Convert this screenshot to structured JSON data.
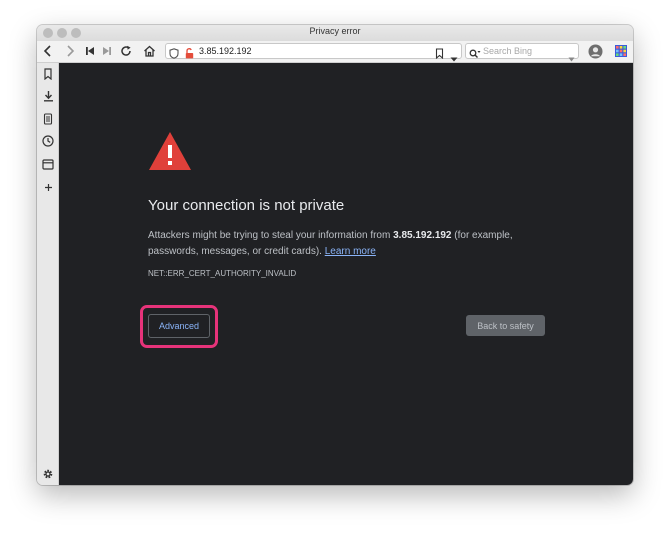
{
  "window": {
    "title": "Privacy error"
  },
  "toolbar": {
    "url": "3.85.192.192",
    "search_placeholder": "Search Bing"
  },
  "page": {
    "heading": "Your connection is not private",
    "description_prefix": "Attackers might be trying to steal your information from ",
    "description_host": "3.85.192.192",
    "description_suffix": " (for example, passwords, messages, or credit cards). ",
    "learn_more": "Learn more",
    "error_code": "NET::ERR_CERT_AUTHORITY_INVALID",
    "advanced_label": "Advanced",
    "back_label": "Back to safety"
  },
  "icons": {
    "warning": "warning-triangle-icon",
    "nav": [
      "back-arrow-icon",
      "forward-arrow-icon",
      "skip-back-icon",
      "skip-forward-icon",
      "reload-icon",
      "home-icon"
    ],
    "sidebar": [
      "bookmark-icon",
      "download-icon",
      "notes-icon",
      "history-icon",
      "tabs-icon",
      "add-icon",
      "settings-icon"
    ]
  },
  "colors": {
    "page_bg": "#202124",
    "warning_red": "#e0403a",
    "link": "#8ab4f8",
    "highlight": "#e6337a",
    "lock_red": "#e44c3a"
  }
}
